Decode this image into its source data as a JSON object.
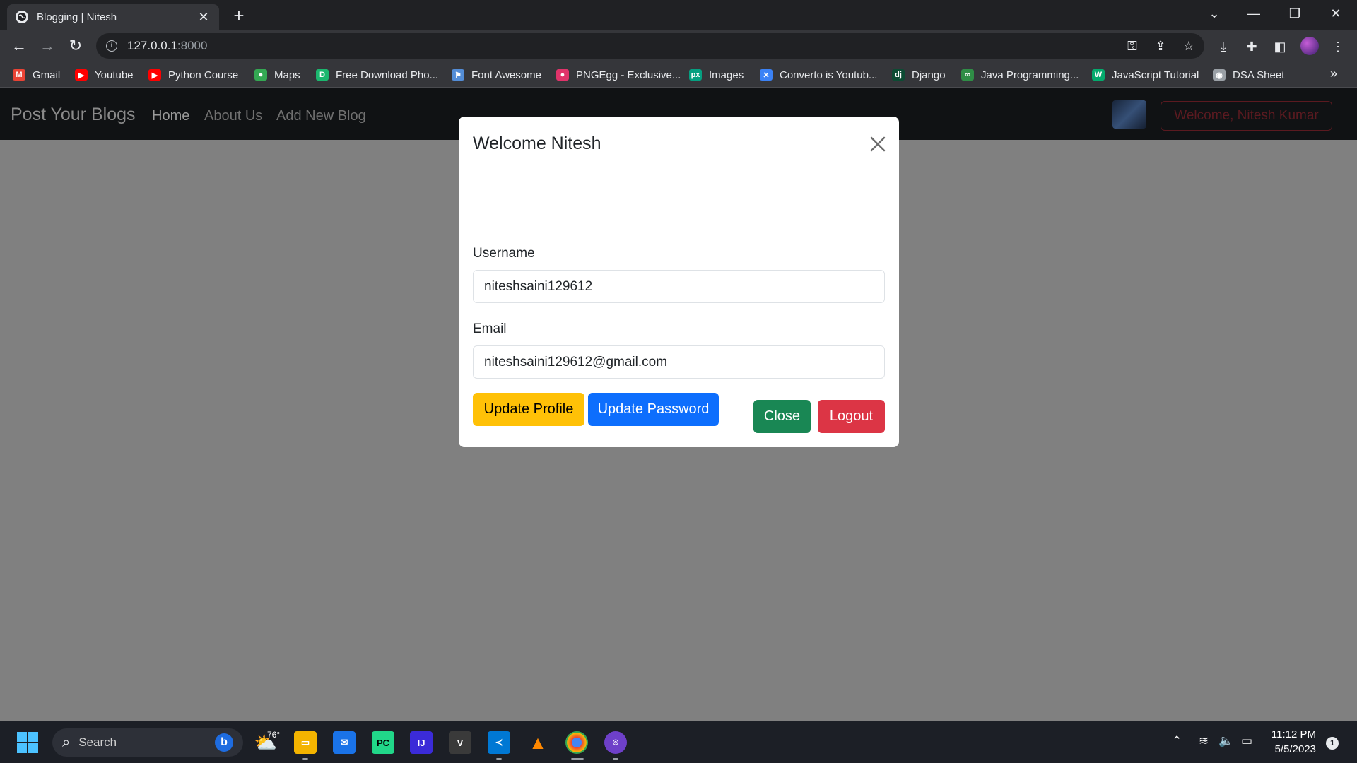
{
  "browser": {
    "tab_title": "Blogging | Nitesh",
    "tab_close": "✕",
    "new_tab": "+",
    "url_host": "127.0.0.1",
    "url_port": ":8000",
    "bookmarks": [
      {
        "label": "Gmail",
        "icon": "gmail-icon",
        "color": "#ea4335",
        "glyph": "M"
      },
      {
        "label": "Youtube",
        "icon": "youtube-icon",
        "color": "#ff0000",
        "glyph": "▶"
      },
      {
        "label": "Python Course",
        "icon": "youtube-icon",
        "color": "#ff0000",
        "glyph": "▶"
      },
      {
        "label": "Maps",
        "icon": "maps-icon",
        "color": "#34a853",
        "glyph": "●"
      },
      {
        "label": "Free Download Pho...",
        "icon": "freepik-icon",
        "color": "#1bb76e",
        "glyph": "D"
      },
      {
        "label": "Font Awesome",
        "icon": "flag-icon",
        "color": "#538dd7",
        "glyph": "⚑"
      },
      {
        "label": "PNGEgg - Exclusive...",
        "icon": "pngegg-icon",
        "color": "#e0336a",
        "glyph": "●"
      },
      {
        "label": "Images",
        "icon": "pexels-icon",
        "color": "#05a081",
        "glyph": "px"
      },
      {
        "label": "Converto is Youtub...",
        "icon": "converto-icon",
        "color": "#3b82f6",
        "glyph": "✕"
      },
      {
        "label": "Django",
        "icon": "django-icon",
        "color": "#0c4b33",
        "glyph": "dj"
      },
      {
        "label": "Java Programming...",
        "icon": "gfg-icon",
        "color": "#2f8d46",
        "glyph": "∞"
      },
      {
        "label": "JavaScript Tutorial",
        "icon": "w3schools-icon",
        "color": "#04aa6d",
        "glyph": "W"
      },
      {
        "label": "DSA Sheet",
        "icon": "globe-icon",
        "color": "#9aa0a6",
        "glyph": "◉"
      }
    ]
  },
  "site": {
    "brand": "Post Your Blogs",
    "nav": {
      "home": "Home",
      "about": "About Us",
      "add": "Add New Blog"
    },
    "welcome": "Welcome, Nitesh Kumar"
  },
  "modal": {
    "title": "Welcome Nitesh",
    "username_label": "Username",
    "username_value": "niteshsaini129612",
    "email_label": "Email",
    "email_value": "niteshsaini129612@gmail.com",
    "update_profile": "Update Profile",
    "update_password": "Update Password",
    "close": "Close",
    "logout": "Logout"
  },
  "taskbar": {
    "search": "Search",
    "bing": "b",
    "weather_temp": "76°",
    "time": "11:12 PM",
    "date": "5/5/2023",
    "notifications": "1"
  }
}
